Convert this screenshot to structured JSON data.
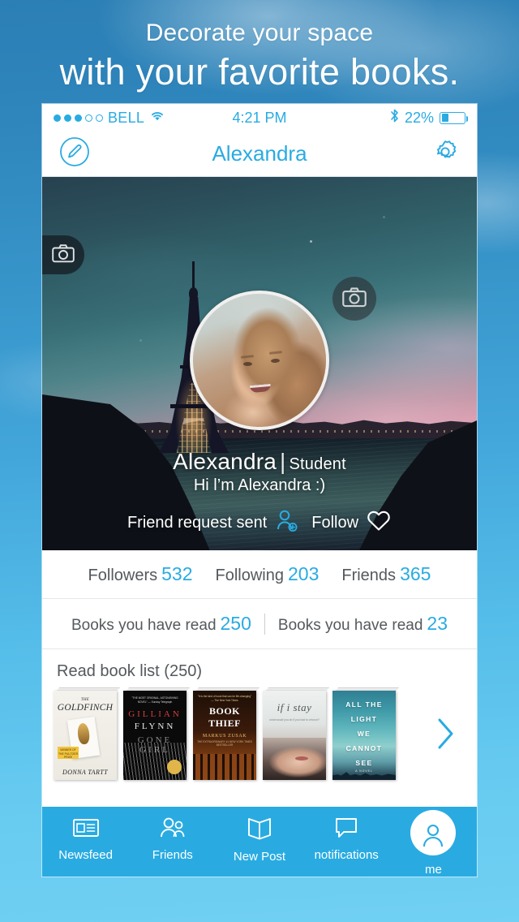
{
  "promo": {
    "line1": "Decorate your space",
    "line2": "with your favorite books."
  },
  "status_bar": {
    "carrier": "BELL",
    "signal_dots_filled": 3,
    "signal_dots_total": 5,
    "wifi_icon": "wifi-icon",
    "time": "4:21 PM",
    "bluetooth_icon": "bluetooth-icon",
    "battery_percent": "22%",
    "battery_level": 22
  },
  "nav_bar": {
    "edit_icon": "edit-pencil-icon",
    "title": "Alexandra",
    "settings_icon": "gear-icon"
  },
  "hero": {
    "cover_camera_icon": "camera-icon",
    "avatar_camera_icon": "camera-icon",
    "name": "Alexandra",
    "separator": "|",
    "role": "Student",
    "bio": "Hi l’m Alexandra :)",
    "friend_action_label": "Friend request sent",
    "friend_action_icon": "add-person-icon",
    "follow_label": "Follow",
    "follow_icon": "heart-icon"
  },
  "stats": [
    {
      "label": "Followers",
      "value": "532"
    },
    {
      "label": "Following",
      "value": "203"
    },
    {
      "label": "Friends",
      "value": "365"
    }
  ],
  "books_read": [
    {
      "label": "Books you have read",
      "value": "250"
    },
    {
      "label": "Books you have read",
      "value": "23"
    }
  ],
  "read_list": {
    "title": "Read book list (250)",
    "next_icon": "chevron-right-icon",
    "books": [
      {
        "title": "The Goldfinch",
        "title_small": "THE",
        "title_main": "GOLDFINCH",
        "author": "DONNA TARTT",
        "badge": "WINNER OF THE PULITZER PRIZE"
      },
      {
        "title": "Gone Girl",
        "author_line1": "GILLIAN",
        "author_line2": "FLYNN",
        "title_line": "GONE GIRL",
        "blurb": "\"THE MOST ORIGINAL, ASTONISHING NOVEL\" — Sunday Telegraph"
      },
      {
        "title": "The Book Thief",
        "title_line1": "BOOK",
        "title_line2": "THIEF",
        "title_small": "THE",
        "author": "MARKUS ZUSAK",
        "subtitle": "THE EXTRAORDINARY #1 NEW YORK TIMES BESTSELLER",
        "top_blurb": "\"It is the kind of book that can be life-changing\" — The New York Times"
      },
      {
        "title": "if i stay",
        "subtitle": "what would you do if you had to choose?"
      },
      {
        "title": "All the Light We Cannot See",
        "lines": [
          "ALL THE",
          "LIGHT",
          "WE",
          "CANNOT",
          "SEE"
        ],
        "tag": "A NOVEL"
      }
    ]
  },
  "tab_bar": {
    "items": [
      {
        "label": "Newsfeed",
        "icon": "newsfeed-icon",
        "active": false
      },
      {
        "label": "Friends",
        "icon": "friends-icon",
        "active": false
      },
      {
        "label": "New Post",
        "icon": "open-book-icon",
        "active": false
      },
      {
        "label": "notifications",
        "icon": "chat-bubble-icon",
        "active": false
      },
      {
        "label": "me",
        "icon": "person-icon",
        "active": true
      }
    ]
  },
  "colors": {
    "accent": "#29abe2",
    "backdrop_top": "#2b7fb5",
    "backdrop_bottom": "#71d0f3",
    "text_muted": "#55595c"
  }
}
